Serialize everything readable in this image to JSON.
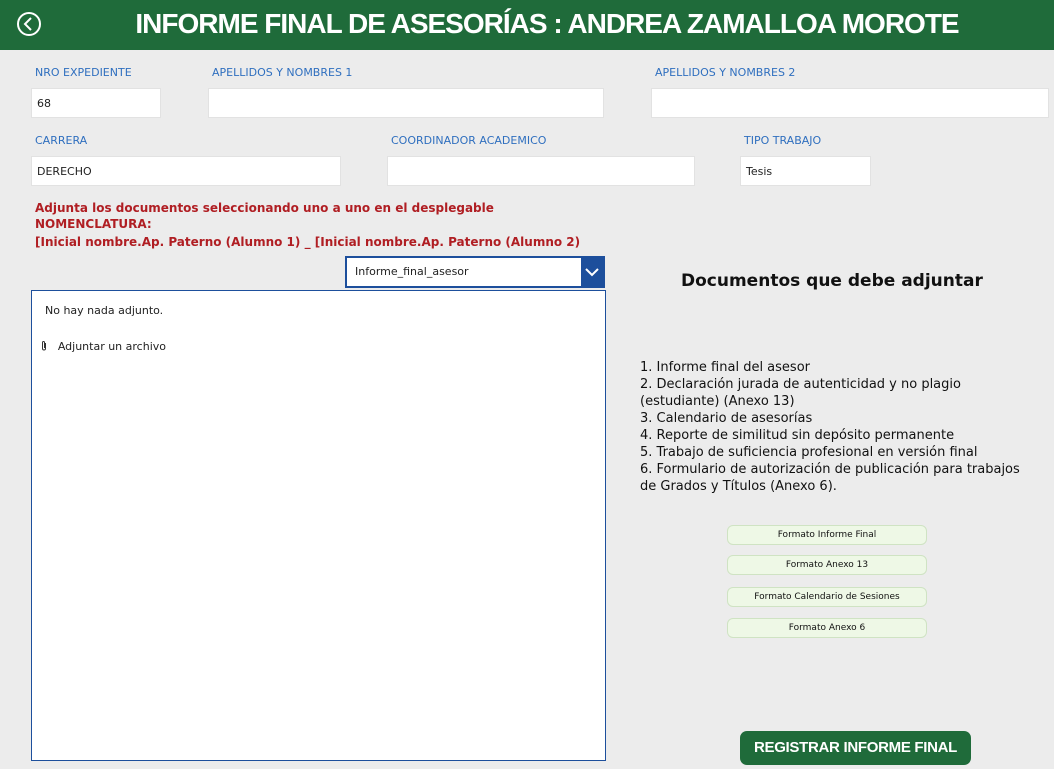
{
  "header": {
    "title": "INFORME FINAL DE ASESORÍAS : ANDREA ZAMALLOA MOROTE",
    "back_icon": "circle-chevron-left-icon"
  },
  "form": {
    "nro_expediente": {
      "label": "NRO EXPEDIENTE",
      "value": "68"
    },
    "apellidos_1": {
      "label": "APELLIDOS Y NOMBRES 1",
      "value": ""
    },
    "apellidos_2": {
      "label": "APELLIDOS Y NOMBRES 2",
      "value": ""
    },
    "carrera": {
      "label": "CARRERA",
      "value": "DERECHO"
    },
    "coordinador": {
      "label": "COORDINADOR ACADEMICO",
      "value": ""
    },
    "tipo_trabajo": {
      "label": "TIPO TRABAJO",
      "value": "Tesis"
    }
  },
  "instructions": {
    "line1": "Adjunta los documentos seleccionando uno a uno en el desplegable",
    "line2": "NOMENCLATURA:",
    "line3": "[Inicial nombre.Ap. Paterno (Alumno 1) _ [Inicial nombre.Ap. Paterno (Alumno 2)"
  },
  "dropdown": {
    "selected": "Informe_final_asesor"
  },
  "attachments": {
    "empty_text": "No hay nada adjunto.",
    "attach_label": "Adjuntar un archivo"
  },
  "docs": {
    "title": "Documentos que debe adjuntar",
    "items": [
      "1. Informe final del asesor",
      "2. Declaración jurada de autenticidad y no plagio (estudiante) (Anexo 13)",
      "3. Calendario de asesorías",
      "4. Reporte de similitud sin depósito permanente",
      "5. Trabajo de suficiencia profesional en versión final",
      "6. Formulario de autorización de publicación para trabajos de Grados y Títulos (Anexo 6)."
    ]
  },
  "format_buttons": [
    "Formato Informe Final",
    "Formato Anexo 13",
    "Formato Calendario de Sesiones",
    "Formato Anexo 6"
  ],
  "register_button": "REGISTRAR INFORME FINAL",
  "colors": {
    "header_bg": "#1f6b3a",
    "label_blue": "#2f6fbf",
    "instruction_red": "#b01e23",
    "dropdown_blue": "#1d4f9c"
  }
}
